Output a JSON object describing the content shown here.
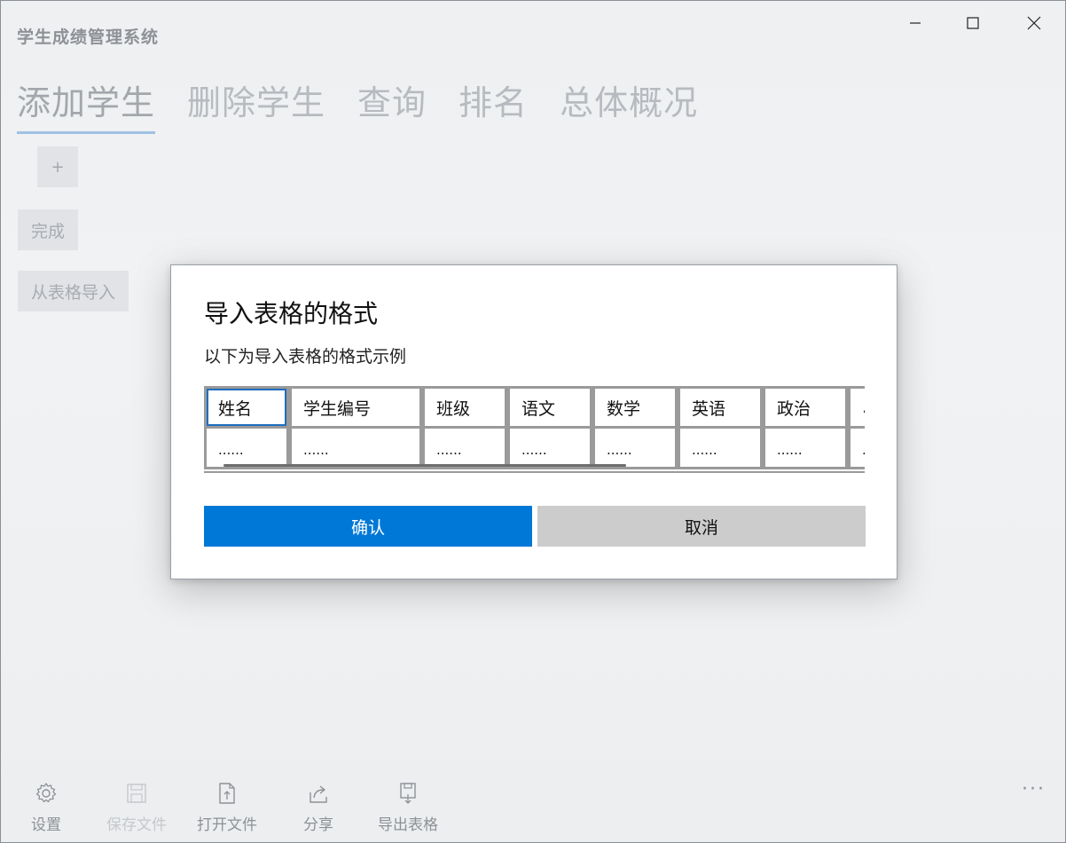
{
  "window": {
    "title": "学生成绩管理系统",
    "controls": {
      "minimize": "minimize-icon",
      "maximize": "maximize-icon",
      "close": "close-icon"
    }
  },
  "tabs": [
    {
      "label": "添加学生",
      "active": true
    },
    {
      "label": "删除学生",
      "active": false
    },
    {
      "label": "查询",
      "active": false
    },
    {
      "label": "排名",
      "active": false
    },
    {
      "label": "总体概况",
      "active": false
    }
  ],
  "sidebar": {
    "add_label": "+",
    "done_label": "完成",
    "import_label": "从表格导入"
  },
  "dialog": {
    "title": "导入表格的格式",
    "description": "以下为导入表格的格式示例",
    "columns": [
      "姓名",
      "学生编号",
      "班级",
      "语文",
      "数学",
      "英语",
      "政治",
      "..."
    ],
    "placeholder_row": [
      "......",
      "......",
      "......",
      "......",
      "......",
      "......",
      "......",
      "..."
    ],
    "confirm_label": "确认",
    "cancel_label": "取消"
  },
  "commandbar": {
    "items": [
      {
        "label": "设置",
        "icon": "gear-icon",
        "enabled": true
      },
      {
        "label": "保存文件",
        "icon": "save-icon",
        "enabled": false
      },
      {
        "label": "打开文件",
        "icon": "open-file-icon",
        "enabled": true
      },
      {
        "label": "分享",
        "icon": "share-icon",
        "enabled": true
      },
      {
        "label": "导出表格",
        "icon": "export-icon",
        "enabled": true
      }
    ],
    "more_label": "···"
  },
  "colors": {
    "accent": "#0078d7",
    "cancel_bg": "#cccccc",
    "tab_underline": "#9fc1e5"
  }
}
